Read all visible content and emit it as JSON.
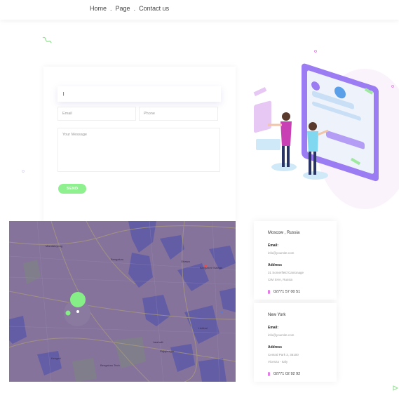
{
  "breadcrumb": {
    "home": "Home",
    "page": "Page",
    "contact": "Contact us",
    "separator": "."
  },
  "form": {
    "name_value": "|",
    "email_placeholder": "Email",
    "phone_placeholder": "Phone",
    "message_placeholder": "Your Message",
    "send_label": "SEND"
  },
  "map": {
    "labels": [
      "Mandaluyong",
      "Bengaluru",
      "Ottawa",
      "Bangalore Nathan",
      "Kengeri",
      "Bengaluru Tech",
      "Jalahalli",
      "Rajajinagar",
      "Hebbal"
    ]
  },
  "contacts": [
    {
      "city": "Moscow , Russia",
      "email_label": "Email:",
      "email": "info@yoursite.com",
      "address_label": "Address",
      "address_line1": "31 Somerfield Cantonage",
      "address_line2": "CIM SHA, Russia",
      "phone": "02771 57 00 51"
    },
    {
      "city": "New York",
      "email_label": "Email:",
      "email": "info@yoursite.com",
      "address_label": "Address",
      "address_line1": "Central Park 3, 36100",
      "address_line2": "Vicenza - Italy",
      "phone": "02771 02 92 92"
    }
  ],
  "colors": {
    "accent_green": "#8ff08f",
    "accent_purple": "#8b6cf0",
    "map_overlay": "#86739c"
  }
}
